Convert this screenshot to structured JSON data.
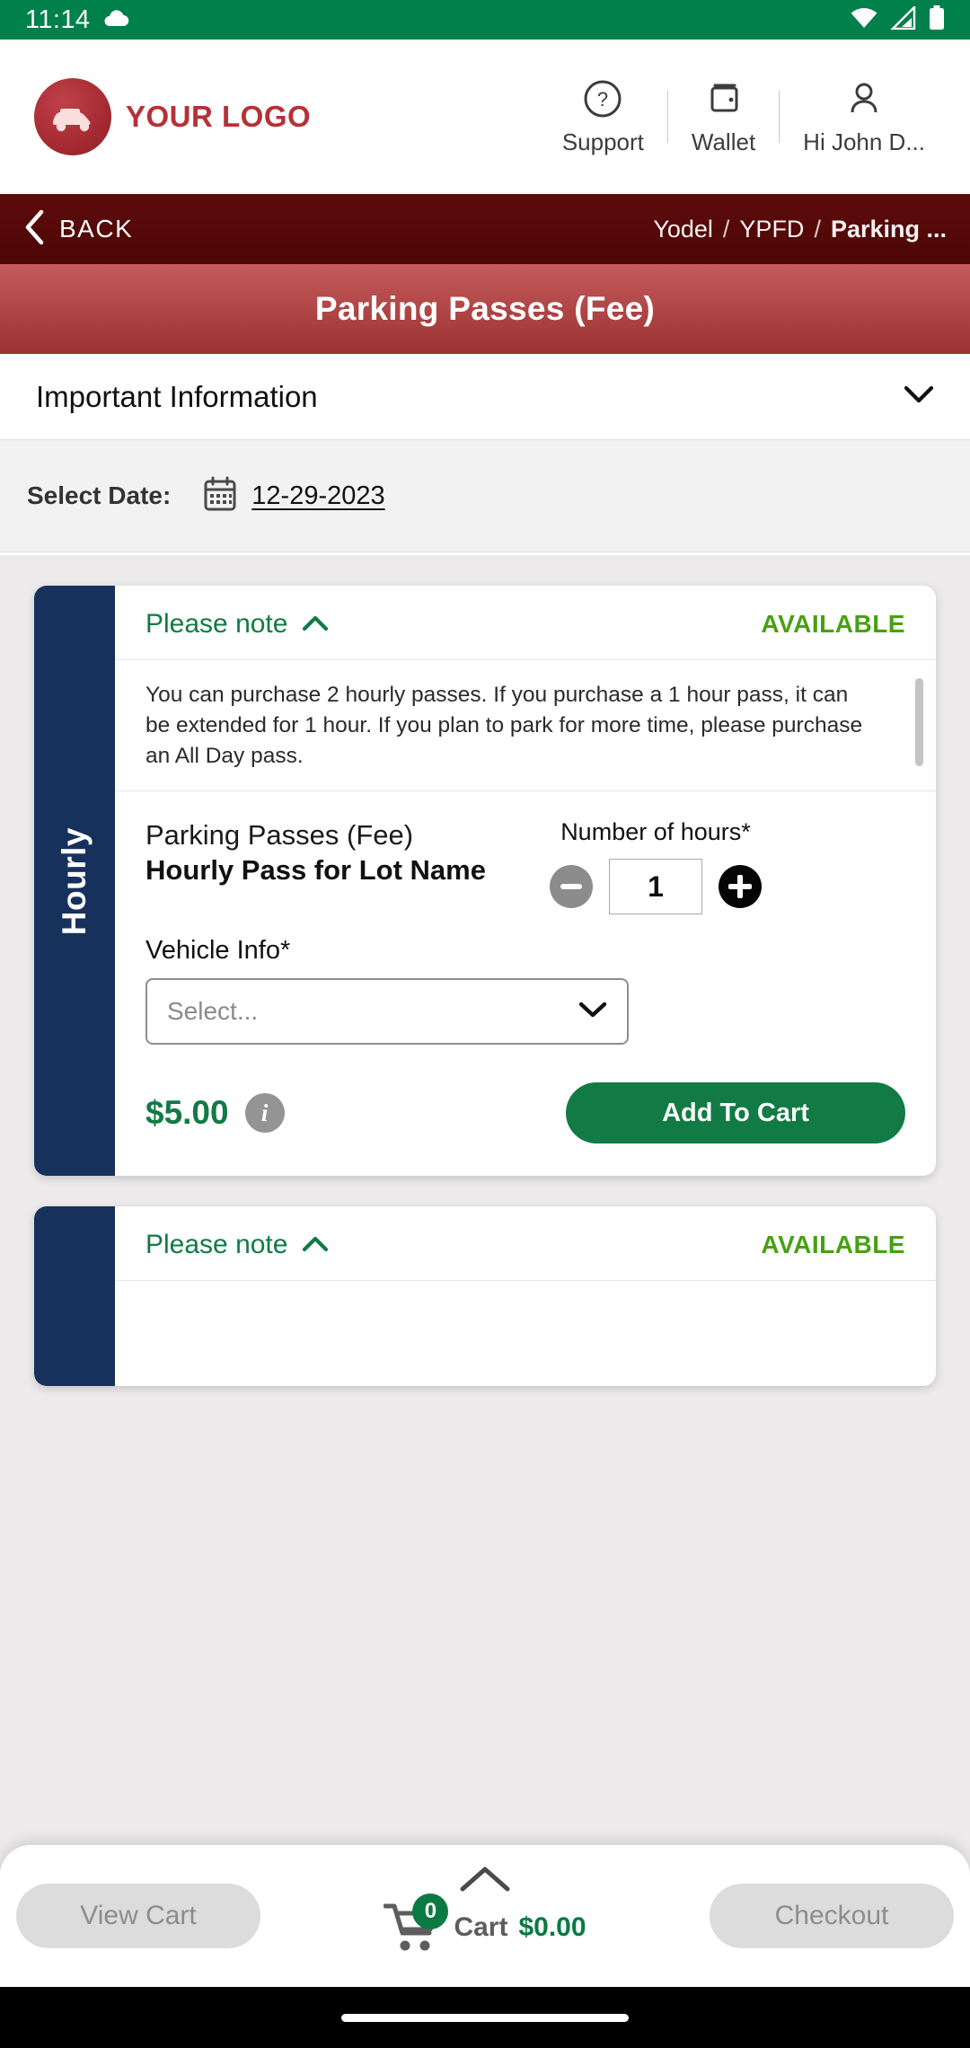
{
  "status_bar": {
    "time": "11:14",
    "icons": [
      "cloud-icon",
      "wifi-icon",
      "signal-icon",
      "battery-icon"
    ],
    "background": "#00804a"
  },
  "header": {
    "logo_text": "YOUR LOGO",
    "logo_icon": "car-logo-icon",
    "nav": [
      {
        "label": "Support",
        "icon": "question-circle-icon"
      },
      {
        "label": "Wallet",
        "icon": "wallet-icon"
      },
      {
        "label": "Hi John D...",
        "icon": "person-icon"
      }
    ]
  },
  "breadcrumb_bar": {
    "back_label": "BACK",
    "back_icon": "chevron-left-icon",
    "crumbs": [
      "Yodel",
      "YPFD",
      "Parking ..."
    ],
    "separator": "/",
    "background": "#4d0606"
  },
  "page_title": {
    "text": "Parking Passes (Fee)",
    "background": "#9c3232"
  },
  "important_information": {
    "label": "Important Information",
    "chevron": "chevron-down-icon"
  },
  "date_row": {
    "label": "Select Date:",
    "icon": "calendar-icon",
    "value": "12-29-2023"
  },
  "cards": [
    {
      "rail_label": "Hourly",
      "rail_color": "#16315c",
      "note_title": "Please note",
      "note_chevron": "chevron-up-icon",
      "availability": "AVAILABLE",
      "availability_color": "#46a112",
      "note_text": "You can purchase 2 hourly passes. If you purchase a 1 hour pass, it can be extended for 1 hour. If you plan to park for more time, please purchase an All Day pass.",
      "product_category": "Parking Passes (Fee)",
      "product_name": "Hourly Pass for Lot Name",
      "hours_label": "Number of hours*",
      "hours_value": "1",
      "minus_icon": "minus-icon",
      "plus_icon": "plus-icon",
      "vehicle_label": "Vehicle Info*",
      "vehicle_value": "Select...",
      "vehicle_chevron": "chevron-down-icon",
      "price": "$5.00",
      "price_color": "#117a45",
      "info_icon": "info-icon",
      "add_to_cart_label": "Add To Cart",
      "add_to_cart_color": "#117a45"
    },
    {
      "rail_label": "",
      "rail_color": "#16315c",
      "note_title": "Please note",
      "note_chevron": "chevron-up-icon",
      "availability": "AVAILABLE",
      "availability_color": "#46a112"
    }
  ],
  "bottom_sheet": {
    "handle_icon": "chevron-up-icon",
    "view_cart_label": "View Cart",
    "cart_icon": "shopping-cart-icon",
    "cart_badge": "0",
    "cart_word": "Cart",
    "cart_total": "$0.00",
    "checkout_label": "Checkout"
  }
}
